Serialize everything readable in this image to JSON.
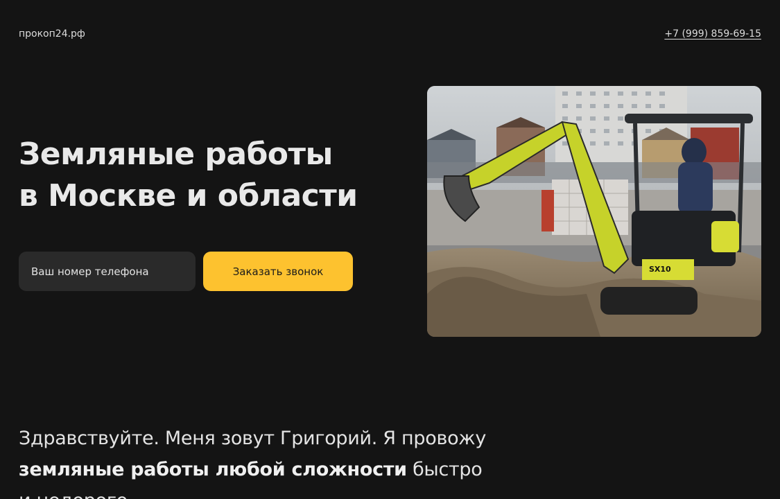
{
  "header": {
    "brand": "прокоп24.рф",
    "phone": "+7 (999) 859-69-15"
  },
  "hero": {
    "title_line1": "Земляные работы",
    "title_line2": "в Москве и области",
    "phone_placeholder": "Ваш номер телефона",
    "cta_label": "Заказать звонок",
    "photo_marking": "SX10"
  },
  "intro": {
    "part1": "Здравствуйте. Меня зовут Григорий. Я провожу",
    "bold": "земляные работы любой сложности",
    "part2": " быстро",
    "part3": "и недорого."
  },
  "colors": {
    "background": "#141414",
    "accent": "#fdc22f",
    "input_bg": "#2a2a2a"
  }
}
